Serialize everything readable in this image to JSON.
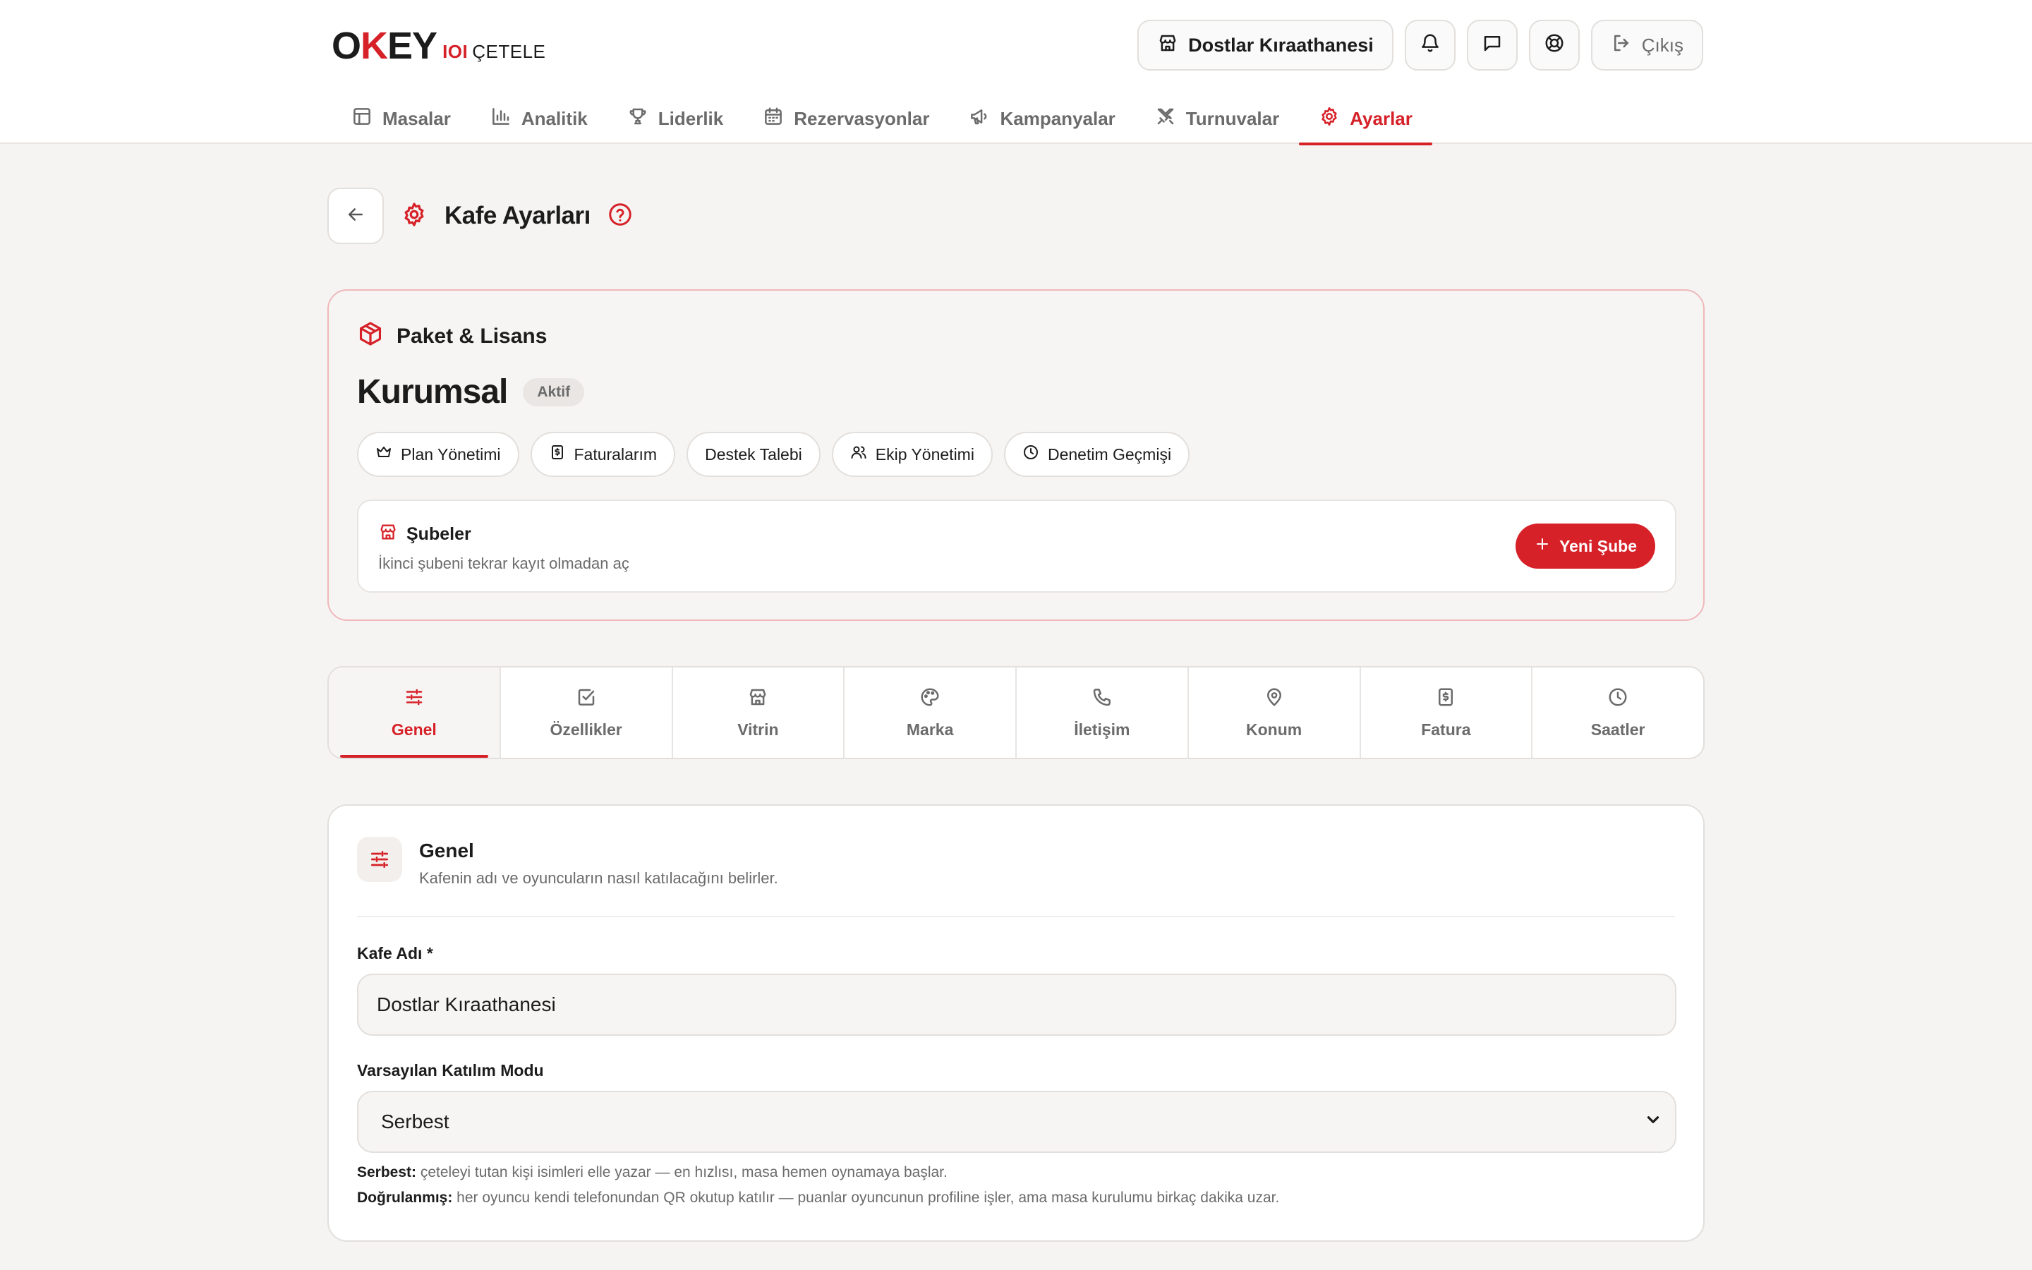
{
  "brand": {
    "logo_main_o": "O",
    "logo_main_k": "K",
    "logo_main_rest": "EY",
    "logo_ioi": "IOI",
    "logo_sub": "ÇETELE"
  },
  "header": {
    "cafe_name": "Dostlar Kıraathanesi",
    "logout_label": "Çıkış",
    "icons": {
      "cafe": "store-icon",
      "notifications": "bell-icon",
      "messages": "message-icon",
      "support": "lifebuoy-icon",
      "logout": "logout-icon"
    }
  },
  "nav": {
    "items": [
      {
        "label": "Masalar",
        "icon": "table-icon"
      },
      {
        "label": "Analitik",
        "icon": "bar-chart-icon"
      },
      {
        "label": "Liderlik",
        "icon": "trophy-icon"
      },
      {
        "label": "Rezervasyonlar",
        "icon": "calendar-icon"
      },
      {
        "label": "Kampanyalar",
        "icon": "megaphone-icon"
      },
      {
        "label": "Turnuvalar",
        "icon": "swords-icon"
      },
      {
        "label": "Ayarlar",
        "icon": "gear-icon",
        "active": true
      }
    ]
  },
  "page": {
    "title": "Kafe Ayarları"
  },
  "license": {
    "heading": "Paket & Lisans",
    "plan_name": "Kurumsal",
    "status_badge": "Aktif",
    "links": [
      {
        "label": "Plan Yönetimi",
        "icon": "crown-icon"
      },
      {
        "label": "Faturalarım",
        "icon": "receipt-icon"
      },
      {
        "label": "Destek Talebi"
      },
      {
        "label": "Ekip Yönetimi",
        "icon": "users-icon"
      },
      {
        "label": "Denetim Geçmişi",
        "icon": "clock-icon"
      }
    ],
    "branches": {
      "title": "Şubeler",
      "subtitle": "İkinci şubeni tekrar kayıt olmadan aç",
      "new_button": "Yeni Şube"
    }
  },
  "tabs": [
    {
      "label": "Genel",
      "icon": "sliders-icon",
      "active": true
    },
    {
      "label": "Özellikler",
      "icon": "checkbox-icon"
    },
    {
      "label": "Vitrin",
      "icon": "store-icon"
    },
    {
      "label": "Marka",
      "icon": "palette-icon"
    },
    {
      "label": "İletişim",
      "icon": "phone-icon"
    },
    {
      "label": "Konum",
      "icon": "map-pin-icon"
    },
    {
      "label": "Fatura",
      "icon": "invoice-icon"
    },
    {
      "label": "Saatler",
      "icon": "clock-icon"
    }
  ],
  "general": {
    "title": "Genel",
    "subtitle": "Kafenin adı ve oyuncuların nasıl katılacağını belirler.",
    "cafe_name_label": "Kafe Adı *",
    "cafe_name_value": "Dostlar Kıraathanesi",
    "join_mode_label": "Varsayılan Katılım Modu",
    "join_mode_value": "Serbest",
    "help_free_term": "Serbest:",
    "help_free_text": " çeteleyi tutan kişi isimleri elle yazar — en hızlısı, masa hemen oynamaya başlar.",
    "help_verified_term": "Doğrulanmış:",
    "help_verified_text": " her oyuncu kendi telefonundan QR okutup katılır — puanlar oyuncunun profiline işler, ama masa kurulumu birkaç dakika uzar."
  },
  "colors": {
    "accent": "#d62128",
    "background": "#f5f4f3",
    "text": "#1c1c1c",
    "muted": "#6b6b6b"
  }
}
